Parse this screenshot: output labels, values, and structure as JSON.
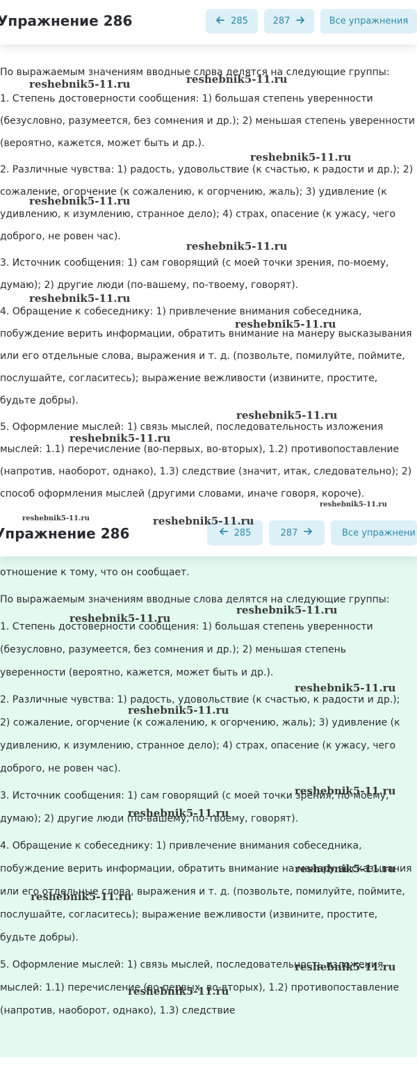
{
  "screen1": {
    "title": "Упражнение 286",
    "prev_label": "285",
    "next_label": "287",
    "all_label": "Все упражнения",
    "cut_text": ", ...",
    "paragraphs": [
      "По выражаемым значениям вводные слова делятся на следующие группы:",
      "1. Степень достоверности сообщения: 1) большая степень уверенности (безусловно, разумеется, без сомнения и др.); 2) меньшая степень уверенности (вероятно, кажется, может быть и др.).",
      "2. Различные чувства: 1) радость, удовольствие (к счастью, к радости и др.); 2) сожаление, огорчение (к сожалению, к огорчению, жаль); 3) удивление (к удивлению, к изумлению, странное дело); 4) страх, опасение (к ужасу, чего доброго, не ровен час).",
      "3. Источник сообщения: 1) сам говорящий (с моей точки зрения, по-моему, думаю); 2) другие люди (по-вашему, по-твоему, говорят).",
      "4. Обращение к собеседнику: 1) привлечение внимания собеседника, побуждение верить информации, обратить внимание на манеру высказывания или его отдельные слова, выражения и т. д. (позвольте, помилуйте, поймите, послушайте, согласитесь); выражение вежливости (извините, простите, будьте добры).",
      "5. Оформление мыслей: 1) связь мыслей, последовательность изложения мыслей: 1.1) перечисление (во-первых, во-вторых), 1.2) противопоставление (напротив, наоборот, однако), 1.3) следствие (значит, итак, следовательно); 2) способ оформления мыслей (другими словами, иначе говоря, короче)."
    ]
  },
  "screen2": {
    "title": "Упражнение 286",
    "prev_label": "285",
    "next_label": "287",
    "all_label": "Все упражнени",
    "paragraphs": [
      "отношение к тому, что он сообщает.",
      "По выражаемым значениям вводные слова делятся на следующие группы:",
      "1. Степень достоверности сообщения: 1) большая степень уверенности (безусловно, разумеется, без сомнения и др.); 2) меньшая степень уверенности (вероятно, кажется, может быть и др.).",
      "2. Различные чувства: 1) радость, удовольствие (к счастью, к радости и др.); 2) сожаление, огорчение (к сожалению, к огорчению, жаль); 3) удивление (к удивлению, к изумлению, странное дело); 4) страх, опасение (к ужасу, чего доброго, не ровен час).",
      "3. Источник сообщения: 1) сам говорящий (с моей точки зрения, по-моему, думаю); 2) другие люди (по-вашему, по-твоему, говорят).",
      "4. Обращение к собеседнику: 1) привлечение внимания собеседника, побуждение верить информации, обратить внимание на манеру высказывания или его отдельные слова, выражения и т. д. (позвольте, помилуйте, поймите, послушайте, согласитесь); выражение вежливости (извините, простите, будьте добры).",
      "5. Оформление мыслей: 1) связь мыслей, последовательность изложения мыслей: 1.1) перечисление (во-первых, во-вторых), 1.2) противопоставление (напротив, наоборот, однако), 1.3) следствие"
    ]
  },
  "watermark": "reshebnik5-11.ru",
  "colors": {
    "accent": "#2d8aa6",
    "button_bg": "#ddf0f8",
    "panel2_bg": "#e3fbef",
    "text": "#2b2b33"
  },
  "icons": [
    "arrow-left-icon",
    "arrow-right-icon"
  ]
}
